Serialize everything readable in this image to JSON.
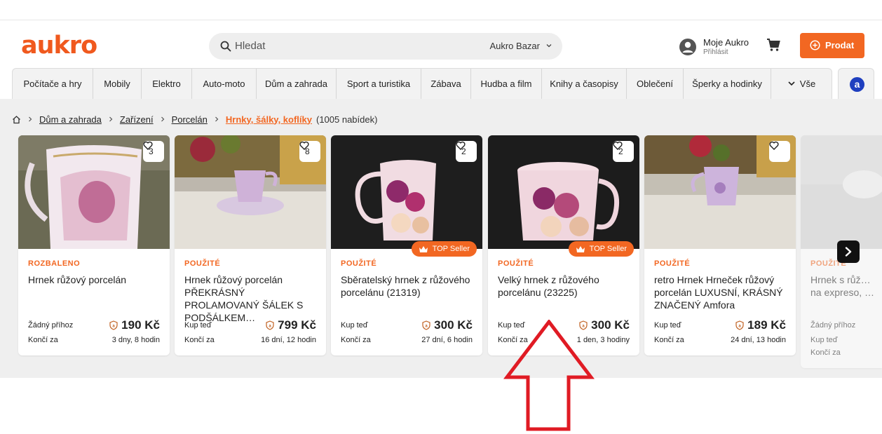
{
  "header": {
    "logo": "aukro",
    "search": {
      "placeholder": "Hledat",
      "scope": "Aukro Bazar"
    },
    "account": {
      "name": "Moje Aukro",
      "sub": "Přihlásit"
    },
    "sell_label": "Prodat",
    "brand_color": "#f26722"
  },
  "categories": [
    "Počítače a hry",
    "Mobily",
    "Elektro",
    "Auto-moto",
    "Dům a zahrada",
    "Sport a turistika",
    "Zábava",
    "Hudba a film",
    "Knihy a časopisy",
    "Oblečení",
    "Šperky a hodinky",
    "Vše"
  ],
  "app_tab": "a",
  "breadcrumb": {
    "items": [
      "Dům a zahrada",
      "Zařízení",
      "Porcelán",
      "Hrnky, šálky, koflíky"
    ],
    "count": "(1005 nabídek)"
  },
  "cards": [
    {
      "likes": "3",
      "condition": "ROZBALENO",
      "title": "Hrnek růžový porcelán",
      "type": "Žádný příhoz",
      "price": "190 Kč",
      "ends_label": "Končí za",
      "time": "3 dny, 8 hodin",
      "top_seller": ""
    },
    {
      "likes": "8",
      "condition": "POUŽITÉ",
      "title": "Hrnek růžový porcelán PŘEKRÁSNÝ PROLAMOVANÝ ŠÁLEK S PODŠÁLKEM…",
      "type": "Kup teď",
      "price": "799 Kč",
      "ends_label": "Končí za",
      "time": "16 dní, 12 hodin",
      "top_seller": ""
    },
    {
      "likes": "2",
      "condition": "POUŽITÉ",
      "title": "Sběratelský hrnek z růžového porcelánu (21319)",
      "type": "Kup teď",
      "price": "300 Kč",
      "ends_label": "Končí za",
      "time": "27 dní, 6 hodin",
      "top_seller": "TOP Seller"
    },
    {
      "likes": "2",
      "condition": "POUŽITÉ",
      "title": "Velký hrnek z růžového porcelánu (23225)",
      "type": "Kup teď",
      "price": "300 Kč",
      "ends_label": "Končí za",
      "time": "1 den, 3 hodiny",
      "top_seller": "TOP Seller"
    },
    {
      "likes": "",
      "condition": "POUŽITÉ",
      "title": "retro Hrnek Hrneček růžový porcelán LUXUSNÍ, KRÁSNÝ ZNAČENÝ Amfora",
      "type": "Kup teď",
      "price": "189 Kč",
      "ends_label": "Končí za",
      "time": "24 dní, 13 hodin",
      "top_seller": ""
    },
    {
      "likes": "",
      "condition": "POUŽITÉ",
      "title": "Hrnek s růž… na expreso, …",
      "type": "Žádný příhoz",
      "price": "",
      "ends_label": "Kup teď",
      "time": "",
      "extra": "Končí za",
      "top_seller": ""
    }
  ],
  "icons": {
    "search": "search-icon",
    "chevron": "chevron-down-icon",
    "avatar": "user-avatar-icon",
    "cart": "cart-icon",
    "plus": "plus-circle-icon",
    "heart": "heart-icon",
    "crown": "crown-icon",
    "shield": "shield-icon",
    "next": "chevron-right-icon",
    "home": "home-icon"
  }
}
